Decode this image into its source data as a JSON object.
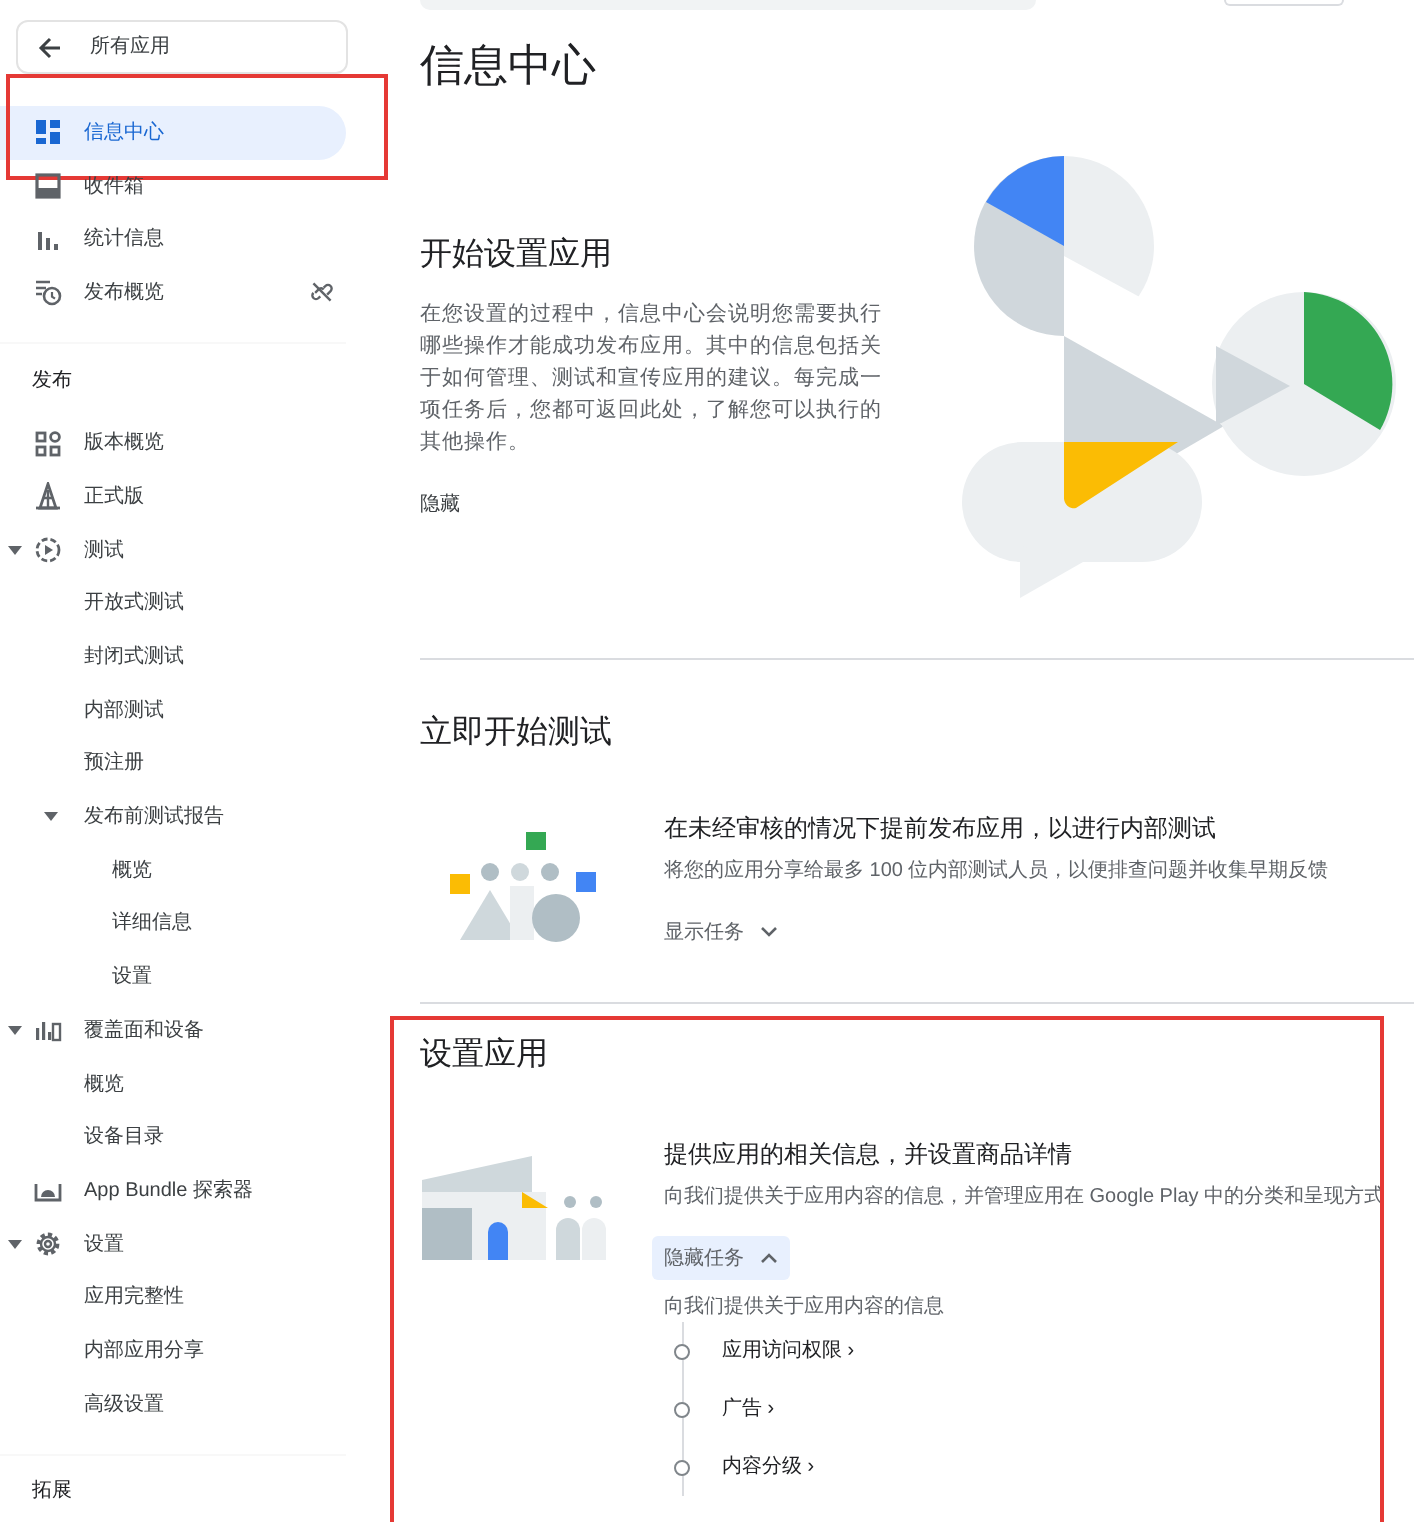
{
  "sidebar": {
    "back_button": {
      "label": "所有应用"
    },
    "items": [
      {
        "label": "信息中心",
        "selected": true,
        "highlighted": true
      },
      {
        "label": "收件箱",
        "selected": false,
        "highlighted": false
      },
      {
        "label": "统计信息",
        "selected": false,
        "highlighted": false
      },
      {
        "label": "发布概览",
        "selected": false,
        "highlighted": false
      }
    ],
    "sections": [
      {
        "title": "发布",
        "items": [
          {
            "label": "版本概览",
            "selected": false
          },
          {
            "label": "正式版",
            "selected": false
          },
          {
            "label": "测试",
            "selected": false,
            "expanded": true,
            "children": [
              {
                "label": "开放式测试",
                "selected": false
              },
              {
                "label": "封闭式测试",
                "selected": false
              },
              {
                "label": "内部测试",
                "selected": false
              },
              {
                "label": "预注册",
                "selected": false
              },
              {
                "label": "发布前测试报告",
                "selected": false,
                "expanded": true,
                "children": [
                  {
                    "label": "概览",
                    "selected": false
                  },
                  {
                    "label": "详细信息",
                    "selected": false
                  },
                  {
                    "label": "设置",
                    "selected": false
                  }
                ]
              }
            ]
          },
          {
            "label": "覆盖面和设备",
            "selected": false,
            "expanded": true,
            "children": [
              {
                "label": "概览",
                "selected": false
              },
              {
                "label": "设备目录",
                "selected": false
              }
            ]
          },
          {
            "label": "App Bundle 探索器",
            "selected": false
          },
          {
            "label": "设置",
            "selected": false,
            "expanded": true,
            "children": [
              {
                "label": "应用完整性",
                "selected": false
              },
              {
                "label": "内部应用分享",
                "selected": false
              },
              {
                "label": "高级设置",
                "selected": false
              }
            ]
          }
        ]
      },
      {
        "title": "拓展"
      }
    ]
  },
  "main": {
    "title": "信息中心",
    "sections": [
      {
        "kind": "intro",
        "heading": "开始设置应用",
        "text": "在您设置的过程中，信息中心会说明您需要执行哪些操作才能成功发布应用。其中的信息包括关于如何管理、测试和宣传应用的建议。每完成一项任务后，您都可返回此处，了解您可以执行的其他操作。",
        "link": "隐藏",
        "highlighted": false
      },
      {
        "kind": "task",
        "heading": "立即开始测试",
        "task_title": "在未经审核的情况下提前发布应用，以进行内部测试",
        "task_subtitle": "将您的应用分享给最多 100 位内部测试人员，以便排查问题并收集早期反馈",
        "toggle": {
          "label": "显示任务",
          "expanded": false
        },
        "highlighted": false
      },
      {
        "kind": "task",
        "heading": "设置应用",
        "task_title": "提供应用的相关信息，并设置商品详情",
        "task_subtitle": "向我们提供关于应用内容的信息，并管理应用在 Google Play 中的分类和呈现方式",
        "toggle": {
          "label": "隐藏任务",
          "expanded": true
        },
        "tasks_label": "向我们提供关于应用内容的信息",
        "tasks": [
          {
            "label": "应用访问权限 ›"
          },
          {
            "label": "广告 ›"
          },
          {
            "label": "内容分级 ›"
          }
        ],
        "highlighted": true
      }
    ]
  }
}
